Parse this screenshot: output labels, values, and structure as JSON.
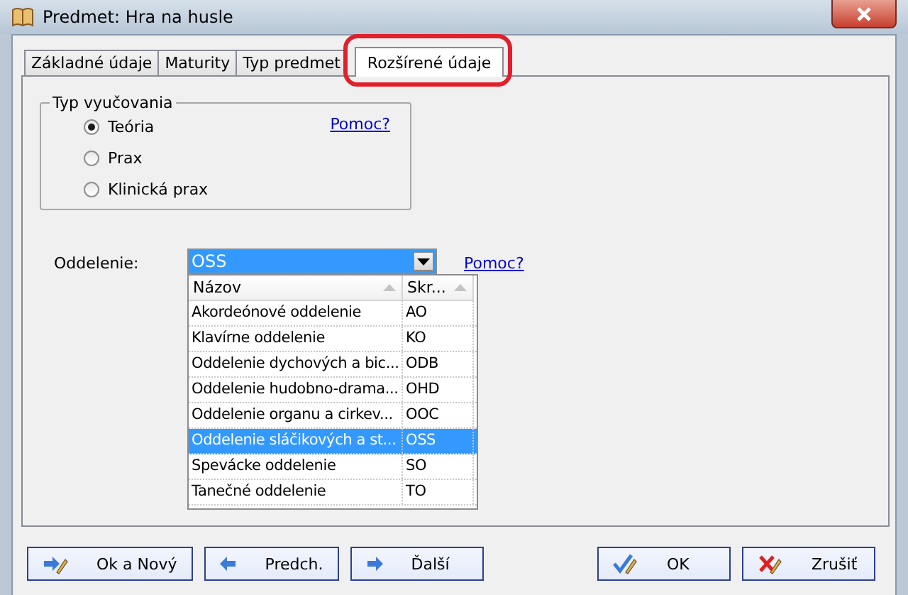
{
  "window": {
    "title": "Predmet: Hra na husle"
  },
  "tabs": [
    {
      "label": "Základné údaje",
      "selected": false
    },
    {
      "label": "Maturity",
      "selected": false
    },
    {
      "label": "Typ predmet",
      "selected": false
    },
    {
      "label": "Rozšírené údaje",
      "selected": true,
      "highlighted": true
    }
  ],
  "teaching_type": {
    "legend": "Typ vyučovania",
    "help_link": "Pomoc?",
    "options": [
      {
        "label": "Teória",
        "selected": true
      },
      {
        "label": "Prax",
        "selected": false
      },
      {
        "label": "Klinická prax",
        "selected": false
      }
    ]
  },
  "department": {
    "label": "Oddelenie:",
    "value": "OSS",
    "help_link": "Pomoc?",
    "columns": [
      "Názov",
      "Skr..."
    ],
    "rows": [
      {
        "name": "Akordeónové oddelenie",
        "code": "AO",
        "selected": false
      },
      {
        "name": "Klavírne oddelenie",
        "code": "KO",
        "selected": false
      },
      {
        "name": "Oddelenie dychových a bic...",
        "code": "ODB",
        "selected": false
      },
      {
        "name": "Oddelenie  hudobno-drama...",
        "code": "OHD",
        "selected": false
      },
      {
        "name": "Oddelenie organu a cirkev...",
        "code": "OOC",
        "selected": false
      },
      {
        "name": "Oddelenie sláčikových a st...",
        "code": "OSS",
        "selected": true
      },
      {
        "name": "Spevácke oddelenie",
        "code": "SO",
        "selected": false
      },
      {
        "name": "Tanečné oddelenie",
        "code": "TO",
        "selected": false
      }
    ]
  },
  "buttons_left": [
    {
      "label": "Ok a Nový",
      "kind": "save-new"
    },
    {
      "label": "Predch.",
      "kind": "prev"
    },
    {
      "label": "Ďalší",
      "kind": "next"
    }
  ],
  "buttons_right": [
    {
      "label": "OK",
      "kind": "ok"
    },
    {
      "label": "Zrušiť",
      "kind": "cancel"
    }
  ]
}
